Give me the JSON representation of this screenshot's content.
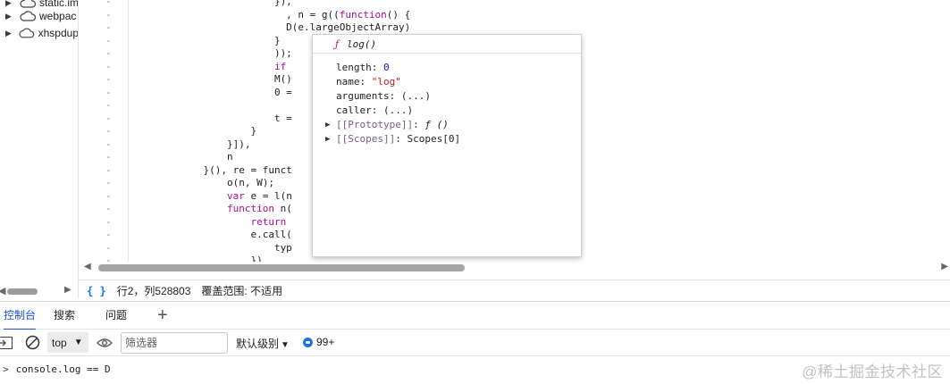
{
  "file_tree": {
    "items": [
      {
        "label": "static.im",
        "icon": "cloud-icon",
        "expanded": false
      },
      {
        "label": "webpac",
        "icon": "cloud-icon",
        "expanded": false
      },
      {
        "label": "xhspdup",
        "icon": "cloud-icon",
        "expanded": false
      }
    ]
  },
  "editor": {
    "gutter_marker": "-",
    "code_lines": [
      "                        }),",
      "                          , n = g((function() {",
      "                          D(e.largeObjectArray)",
      "                        }",
      "                        ));",
      "                        if                                          me, n),",
      "                        M()",
      "                        0 =",
      "",
      "                        t =                                         ()",
      "                    }",
      "                }]),",
      "                n",
      "            }(), re = funct",
      "                o(n, W);",
      "                var e = l(n",
      "                function n(",
      "                    return",
      "                    e.call(",
      "                        typ",
      "                    })"
    ]
  },
  "status": {
    "brace_icon": "{ }",
    "position": "行2，列528803",
    "coverage": "覆盖范围: 不适用"
  },
  "drawer_tabs": [
    {
      "label": "控制台",
      "active": true
    },
    {
      "label": "搜索",
      "active": false
    },
    {
      "label": "问题",
      "active": false
    }
  ],
  "drawer_add_label": "+",
  "console_toolbar": {
    "context": "top",
    "filter_placeholder": "筛选器",
    "levels_label": "默认级别",
    "issues_count": "99+"
  },
  "console": {
    "prompt": ">",
    "expression": "console.log == D"
  },
  "watermark": "@稀土掘金技术社区",
  "popover": {
    "f_glyph": "ƒ",
    "title": "log()",
    "properties": [
      {
        "key": "length",
        "value": "0",
        "type": "number"
      },
      {
        "key": "name",
        "value": "\"log\"",
        "type": "string"
      },
      {
        "key": "arguments",
        "value": "(...)",
        "type": "lazy"
      },
      {
        "key": "caller",
        "value": "(...)",
        "type": "lazy"
      },
      {
        "key": "[[Prototype]]",
        "value": "ƒ ()",
        "type": "function",
        "expandable": true
      },
      {
        "key": "[[Scopes]]",
        "value": "Scopes[0]",
        "type": "plain",
        "expandable": true
      }
    ]
  },
  "colors": {
    "accent": "#1a4fd8",
    "keyword": "#aa0d91",
    "string": "#c41a16",
    "number": "#1a1aa6"
  }
}
